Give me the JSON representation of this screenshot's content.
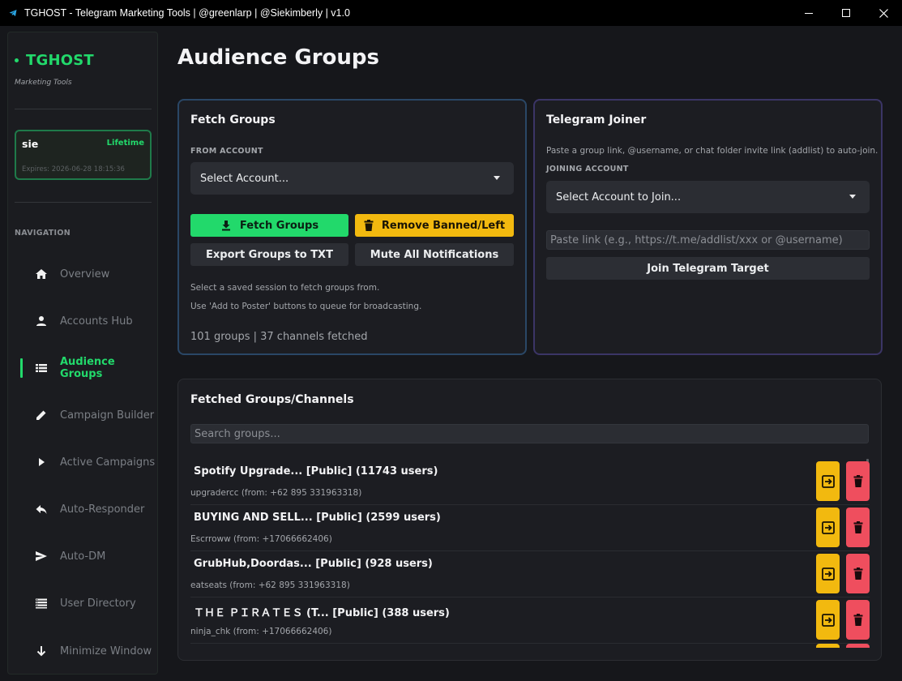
{
  "window": {
    "title": "TGHOST - Telegram Marketing Tools | @greenlarp | @Siekimberly | v1.0",
    "icon": "telegram-icon"
  },
  "sidebar": {
    "brand": "TGHOST",
    "subtitle": "Marketing Tools",
    "user": {
      "name": "sie",
      "plan": "Lifetime",
      "expires": "Expires: 2026-06-28 18:15:36"
    },
    "nav_heading": "NAVIGATION",
    "items": [
      {
        "label": "Overview",
        "icon": "home-icon"
      },
      {
        "label": "Accounts Hub",
        "icon": "person-icon"
      },
      {
        "label": "Audience Groups",
        "icon": "list-icon",
        "active": true
      },
      {
        "label": "Campaign Builder",
        "icon": "pencil-icon"
      },
      {
        "label": "Active Campaigns",
        "icon": "play-icon"
      },
      {
        "label": "Auto-Responder",
        "icon": "reply-icon"
      },
      {
        "label": "Auto-DM",
        "icon": "send-icon"
      },
      {
        "label": "User Directory",
        "icon": "directory-icon"
      },
      {
        "label": "Minimize Window",
        "icon": "arrow-down-icon"
      }
    ]
  },
  "page": {
    "title": "Audience Groups"
  },
  "fetch": {
    "title": "Fetch Groups",
    "from_label": "FROM ACCOUNT",
    "select_value": "Select Account...",
    "fetch_btn": "Fetch Groups",
    "remove_btn": "Remove Banned/Left",
    "export_btn": "Export Groups to TXT",
    "mute_btn": "Mute All Notifications",
    "hint1": "Select a saved session to fetch groups from.",
    "hint2": "Use 'Add to Poster' buttons to queue for broadcasting.",
    "stats": "101 groups | 37 channels fetched"
  },
  "joiner": {
    "title": "Telegram Joiner",
    "description": "Paste a group link, @username, or chat folder invite link (addlist) to auto-join.",
    "account_label": "JOINING ACCOUNT",
    "select_value": "Select Account to Join...",
    "link_placeholder": "Paste link (e.g., https://t.me/addlist/xxx or @username)",
    "join_btn": "Join Telegram Target"
  },
  "list": {
    "title": "Fetched Groups/Channels",
    "search_placeholder": "Search groups...",
    "rows": [
      {
        "title": "Spotify Upgrade... [Public] (11743 users)",
        "sub": "upgradercc (from: +62 895 331963318)"
      },
      {
        "title": "BUYING AND SELL... [Public] (2599 users)",
        "sub": "Escrroww (from: +17066662406)"
      },
      {
        "title": "GrubHub,Doordas... [Public] (928 users)",
        "sub": "eatseats (from: +62 895 331963318)"
      },
      {
        "title": "ＴＨＥ ＰＩＲＡＴＥＳ (T... [Public] (388 users)",
        "sub": "ninja_chk (from: +17066662406)"
      }
    ]
  },
  "colors": {
    "accent": "#22d96b",
    "warning": "#f2b90f",
    "danger": "#ef4e5e"
  }
}
